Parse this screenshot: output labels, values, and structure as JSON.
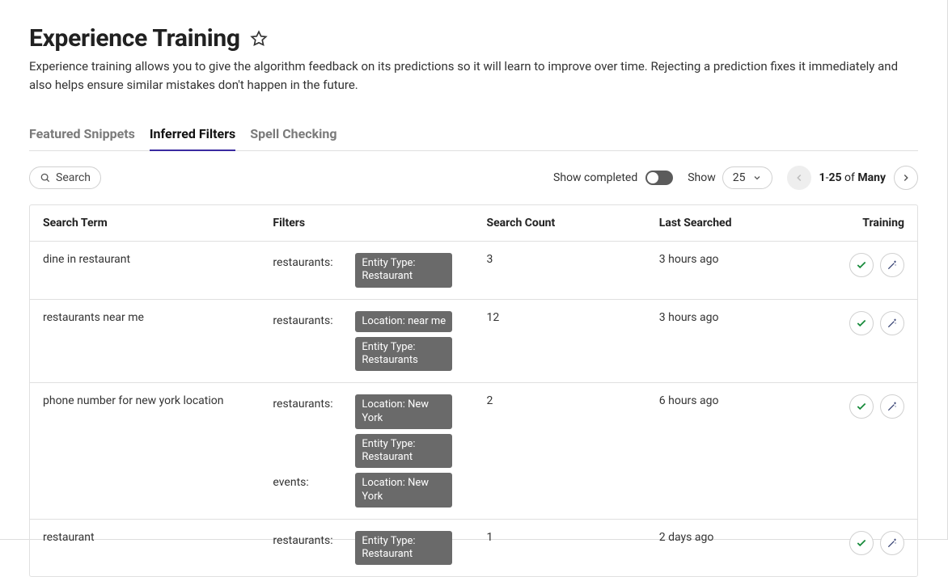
{
  "header": {
    "title": "Experience Training",
    "description": "Experience training allows you to give the algorithm feedback on its predictions so it will learn to improve over time. Rejecting a prediction fixes it immediately and also helps ensure similar mistakes don't happen in the future."
  },
  "tabs": [
    {
      "label": "Featured Snippets",
      "active": false
    },
    {
      "label": "Inferred Filters",
      "active": true
    },
    {
      "label": "Spell Checking",
      "active": false
    }
  ],
  "toolbar": {
    "search_label": "Search",
    "show_completed_label": "Show completed",
    "show_completed": false,
    "show_label": "Show",
    "page_size": "25",
    "range_start": "1",
    "range_end": "25",
    "range_of": "of",
    "range_total": "Many"
  },
  "columns": {
    "term": "Search Term",
    "filters": "Filters",
    "count": "Search Count",
    "last": "Last Searched",
    "training": "Training"
  },
  "rows": [
    {
      "term": "dine in restaurant",
      "filter_groups": [
        {
          "type": "restaurants:",
          "chips": [
            "Entity Type: Restaurant"
          ]
        }
      ],
      "count": "3",
      "last": "3 hours ago"
    },
    {
      "term": "restaurants near me",
      "filter_groups": [
        {
          "type": "restaurants:",
          "chips": [
            "Location: near me",
            "Entity Type: Restaurants"
          ]
        }
      ],
      "count": "12",
      "last": "3 hours ago"
    },
    {
      "term": "phone number for new york location",
      "filter_groups": [
        {
          "type": "restaurants:",
          "chips": [
            "Location: New York",
            "Entity Type: Restaurant"
          ]
        },
        {
          "type": "events:",
          "chips": [
            "Location: New York"
          ]
        }
      ],
      "count": "2",
      "last": "6 hours ago"
    },
    {
      "term": "restaurant",
      "filter_groups": [
        {
          "type": "restaurants:",
          "chips": [
            "Entity Type: Restaurant"
          ]
        }
      ],
      "count": "1",
      "last": "2 days ago"
    }
  ]
}
